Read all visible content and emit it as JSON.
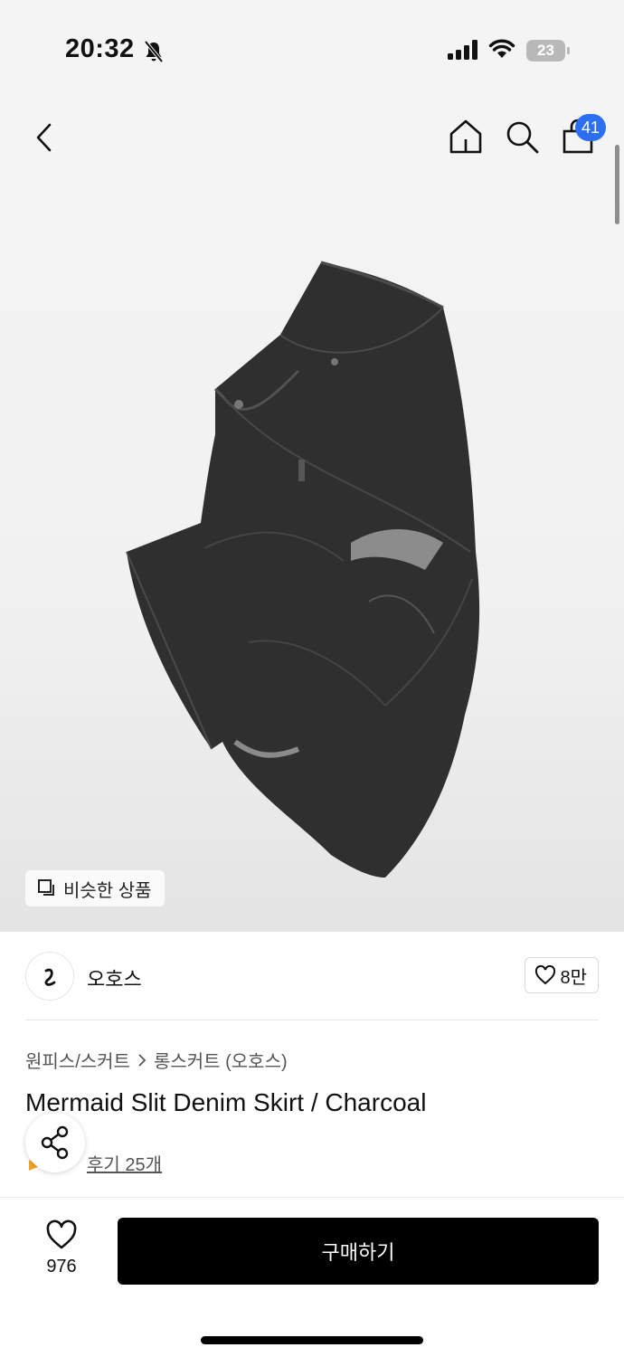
{
  "status_bar": {
    "time": "20:32",
    "battery": "23"
  },
  "header": {
    "cart_count": "41"
  },
  "hero": {
    "similar_label": "비슷한 상품"
  },
  "brand": {
    "name": "오호스",
    "likes": "8만"
  },
  "breadcrumb": {
    "category": "원피스/스커트",
    "subcategory": "롱스커트 (오호스)"
  },
  "product": {
    "title": "Mermaid Slit Denim Skirt / Charcoal",
    "reviews": "후기 25개"
  },
  "bottom_bar": {
    "wish_count": "976",
    "buy_label": "구매하기"
  },
  "colors": {
    "accent_badge": "#2d6ff2",
    "buy_button": "#000000",
    "denim": "#2f2f2f"
  },
  "icons": [
    "bell-off-icon",
    "signal-icon",
    "wifi-icon",
    "battery-icon",
    "back-arrow-icon",
    "home-icon",
    "search-icon",
    "shopping-bag-icon",
    "similar-icon",
    "heart-icon",
    "share-icon",
    "star-icon",
    "chevron-right-icon"
  ]
}
